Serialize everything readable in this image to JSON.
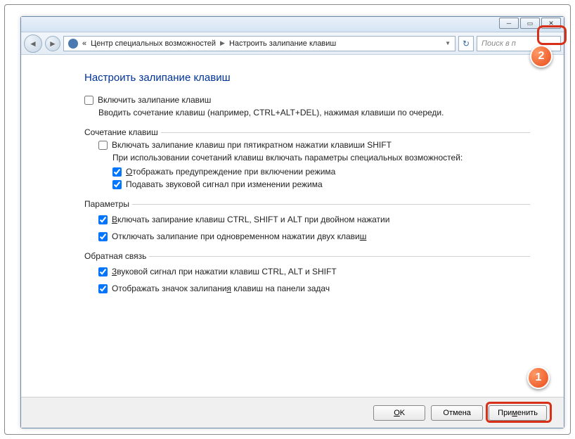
{
  "breadcrumb": {
    "item1": "Центр специальных возможностей",
    "item2": "Настроить залипание клавиш"
  },
  "search": {
    "placeholder": "Поиск в п"
  },
  "page": {
    "title": "Настроить залипание клавиш",
    "enable_label": "Включить залипание клавиш",
    "enable_desc": "Вводить сочетание клавиш (например, CTRL+ALT+DEL), нажимая клавиши по очереди."
  },
  "section_shortcut": {
    "legend": "Сочетание клавиш",
    "shift5_label": "Включать залипание клавиш при пятикратном нажатии клавиши SHIFT",
    "shift5_desc": "При использовании сочетаний клавиш включать параметры специальных возможностей:",
    "warn_label": "Отображать предупреждение при включении режима",
    "sound_label": "Подавать звуковой сигнал при изменении режима"
  },
  "section_params": {
    "legend": "Параметры",
    "lock_label": "Включать запирание клавиш CTRL, SHIFT и ALT при двойном нажатии",
    "release_label": "Отключать залипание при одновременном нажатии двух клавиш"
  },
  "section_feedback": {
    "legend": "Обратная связь",
    "sound_label": "Звуковой сигнал при нажатии клавиш CTRL, ALT и SHIFT",
    "tray_label": "Отображать значок залипания клавиш на панели задач"
  },
  "buttons": {
    "ok": "OK",
    "cancel": "Отмена",
    "apply": "Применить"
  },
  "callouts": {
    "one": "1",
    "two": "2"
  }
}
